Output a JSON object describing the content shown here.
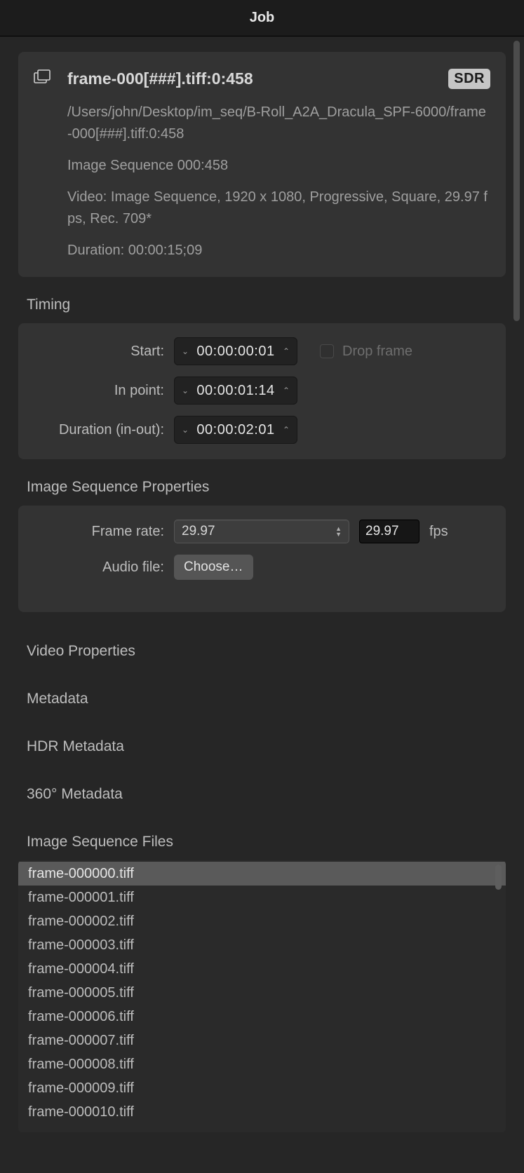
{
  "window_title": "Job",
  "header": {
    "title": "frame-000[###].tiff:0:458",
    "badge": "SDR",
    "path": "/Users/john/Desktop/im_seq/B-Roll_A2A_Dracula_SPF-6000/frame-000[###].tiff:0:458",
    "seq_text": "Image Sequence 000:458",
    "video_text": "Video: Image Sequence, 1920 x 1080, Progressive, Square, 29.97 fps, Rec. 709*",
    "duration_text": "Duration: 00:00:15;09"
  },
  "sections": {
    "timing": "Timing",
    "img_seq_props": "Image Sequence Properties",
    "video_props": "Video Properties",
    "metadata": "Metadata",
    "hdr_metadata": "HDR Metadata",
    "meta360": "360° Metadata",
    "img_seq_files": "Image Sequence Files"
  },
  "timing": {
    "start_label": "Start:",
    "start_value": "00:00:00:01",
    "drop_frame_label": "Drop frame",
    "in_point_label": "In point:",
    "in_point_value": "00:00:01:14",
    "duration_label": "Duration (in-out):",
    "duration_value": "00:00:02:01"
  },
  "img_seq_props": {
    "frame_rate_label": "Frame rate:",
    "frame_rate_select": "29.97",
    "frame_rate_value": "29.97",
    "fps_label": "fps",
    "audio_file_label": "Audio file:",
    "choose_label": "Choose…"
  },
  "files": [
    "frame-000000.tiff",
    "frame-000001.tiff",
    "frame-000002.tiff",
    "frame-000003.tiff",
    "frame-000004.tiff",
    "frame-000005.tiff",
    "frame-000006.tiff",
    "frame-000007.tiff",
    "frame-000008.tiff",
    "frame-000009.tiff",
    "frame-000010.tiff"
  ]
}
